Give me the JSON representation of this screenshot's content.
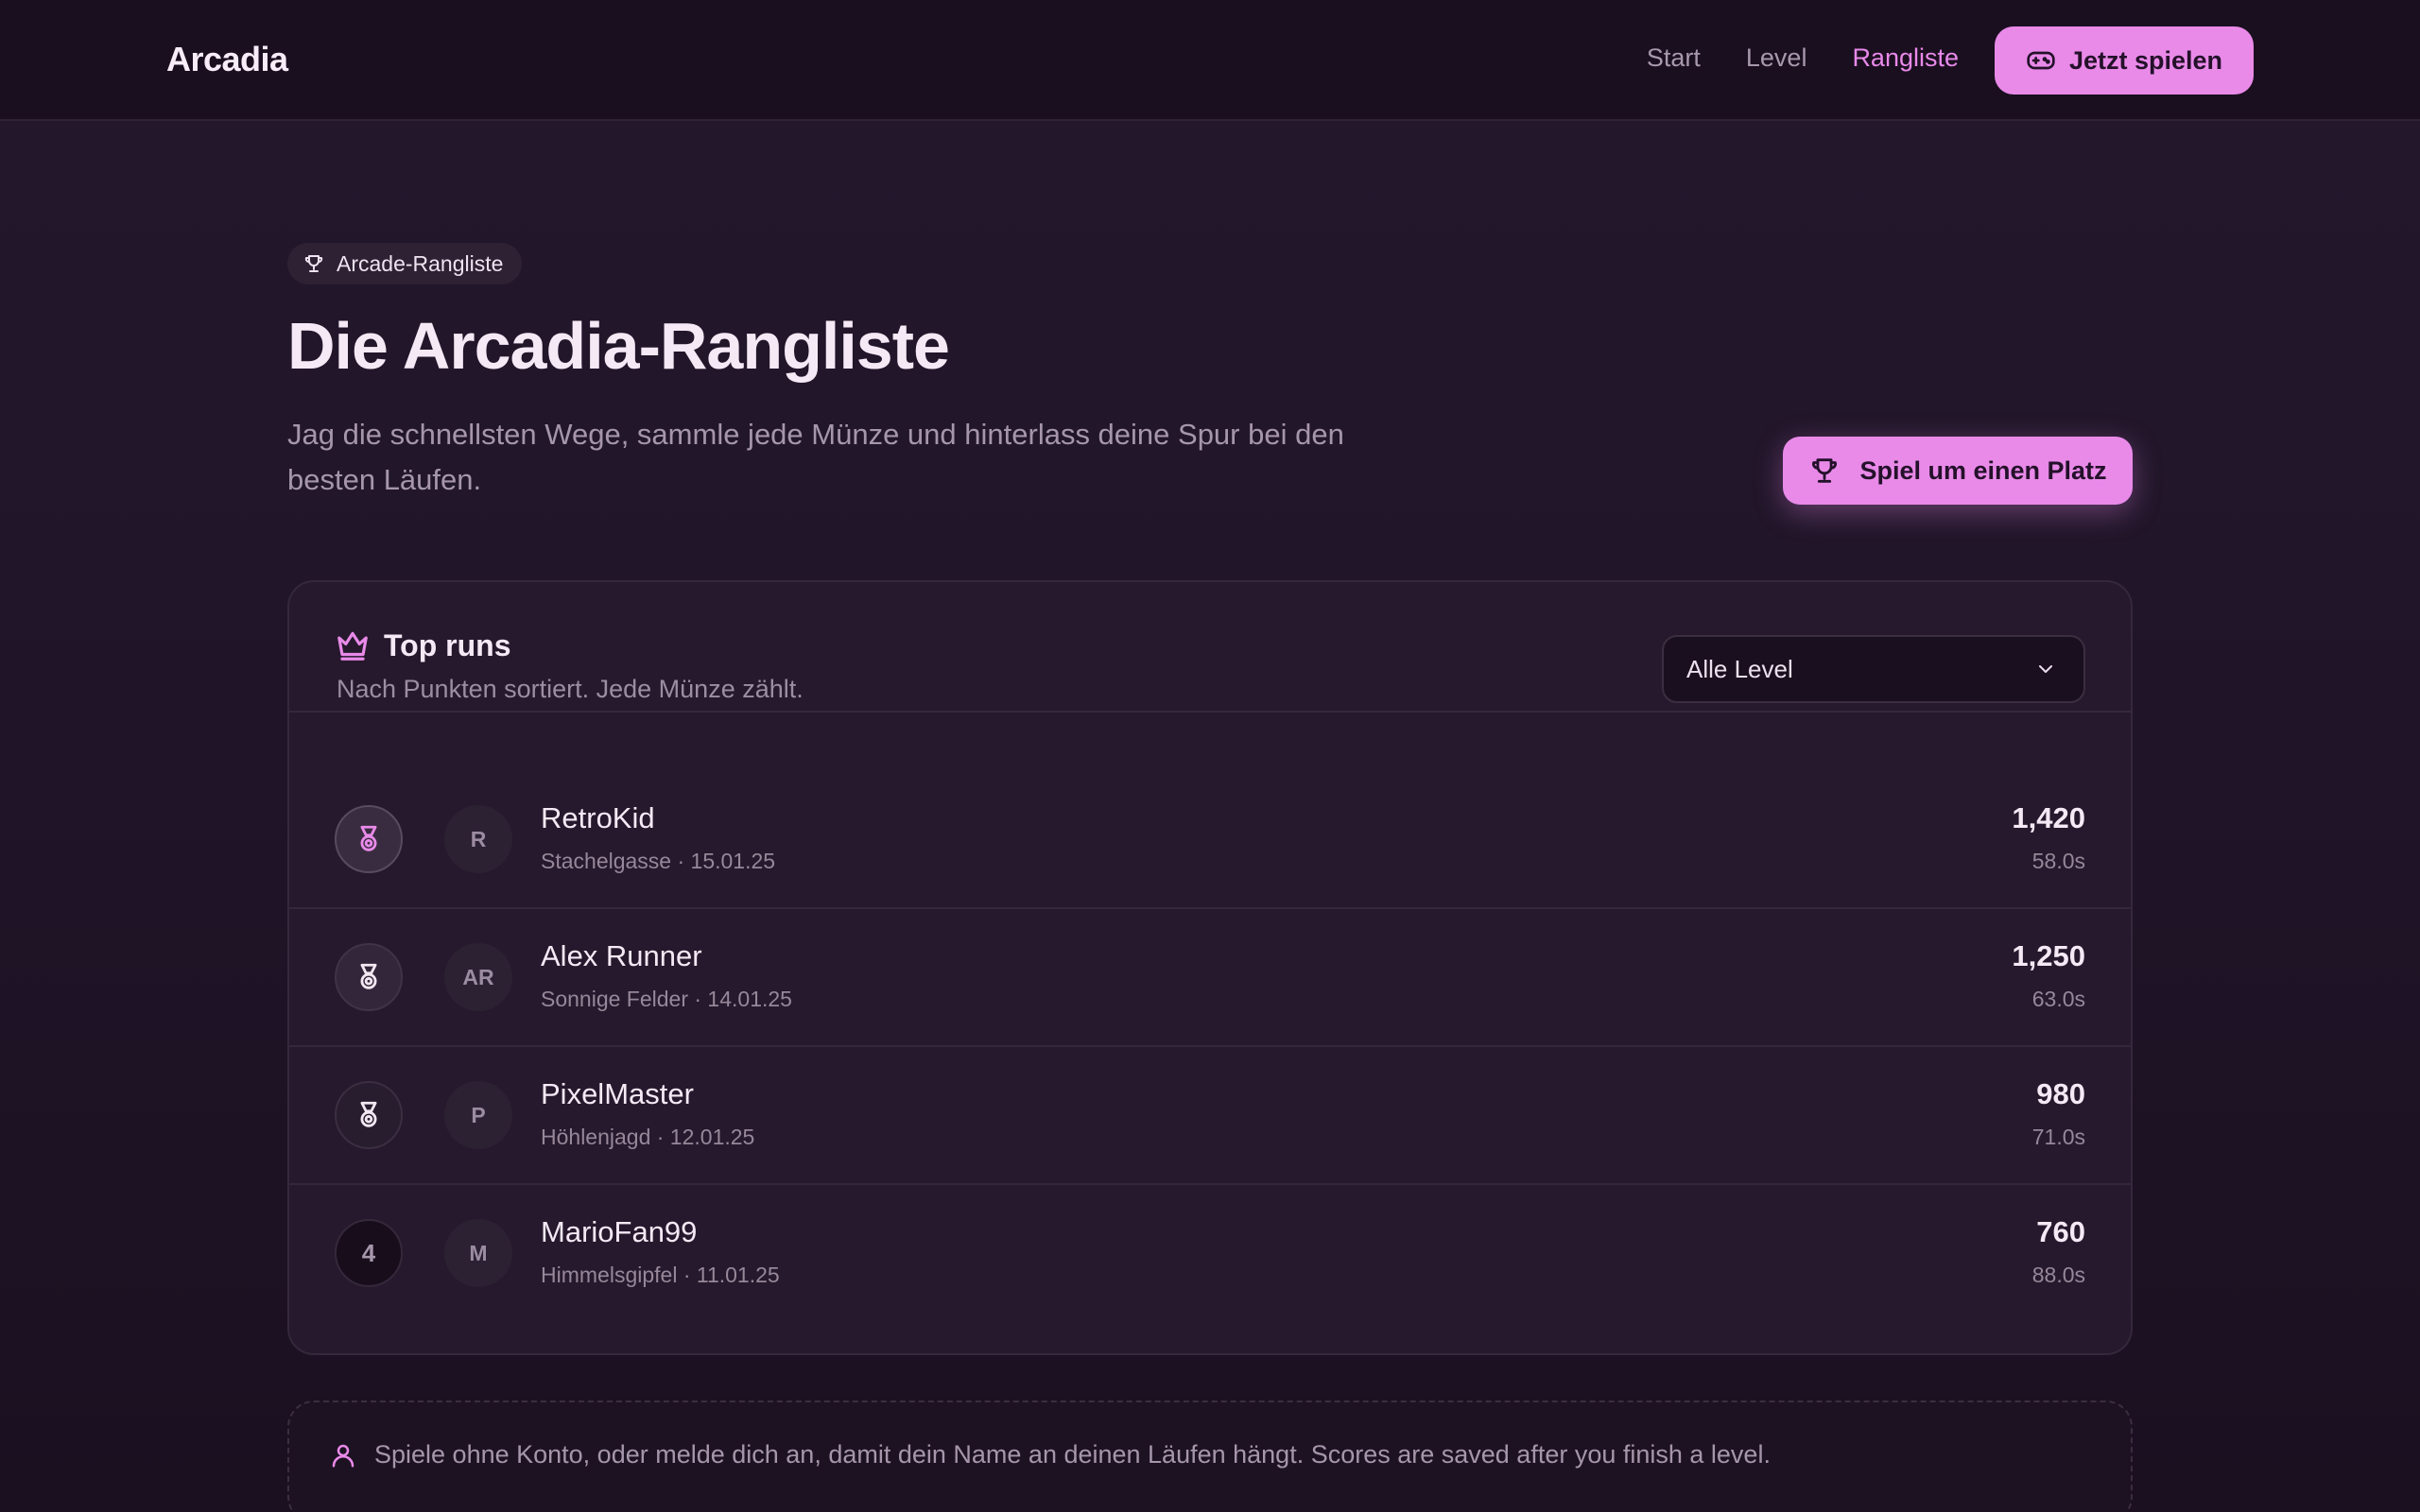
{
  "brand": "Arcadia",
  "nav": {
    "items": [
      {
        "label": "Start"
      },
      {
        "label": "Level"
      },
      {
        "label": "Rangliste",
        "active": true
      }
    ],
    "play_label": "Jetzt spielen"
  },
  "hero": {
    "pill": "Arcade-Rangliste",
    "title": "Die Arcadia-Rangliste",
    "subtitle": "Jag die schnellsten Wege, sammle jede Münze und hinterlass deine Spur bei den besten Läufen.",
    "cta_label": "Spiel um einen Platz"
  },
  "leaderboard": {
    "title": "Top runs",
    "subtitle": "Nach Punkten sortiert. Jede Münze zählt.",
    "filter_value": "Alle Level",
    "rows": [
      {
        "rank": "1",
        "medal": "gold-medal-icon",
        "initials": "R",
        "name": "RetroKid",
        "meta": "Stachelgasse · 15.01.25",
        "score": "1,420",
        "time": "58.0s"
      },
      {
        "rank": "2",
        "medal": "silver-medal-icon",
        "initials": "AR",
        "name": "Alex Runner",
        "meta": "Sonnige Felder · 14.01.25",
        "score": "1,250",
        "time": "63.0s"
      },
      {
        "rank": "3",
        "medal": "bronze-medal-icon",
        "initials": "P",
        "name": "PixelMaster",
        "meta": "Höhlenjagd · 12.01.25",
        "score": "980",
        "time": "71.0s"
      },
      {
        "rank": "4",
        "medal": "",
        "initials": "M",
        "name": "MarioFan99",
        "meta": "Himmelsgipfel · 11.01.25",
        "score": "760",
        "time": "88.0s"
      }
    ]
  },
  "info": {
    "text": "Spiele ohne Konto, oder melde dich an, damit dein Name an deinen Läufen hängt. Scores are saved after you finish a level."
  },
  "colors": {
    "accent": "#e98ae9",
    "background": "#1f1425",
    "card": "#26192d"
  }
}
